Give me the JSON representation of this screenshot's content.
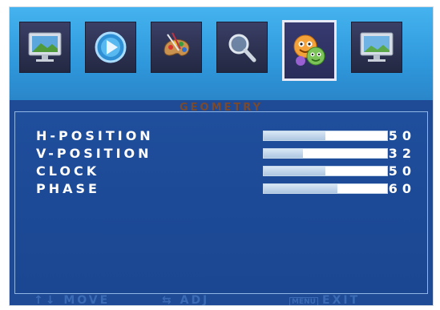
{
  "section_title": "GEOMETRY",
  "menu_icons": [
    {
      "name": "monitor-picture-icon",
      "active": false
    },
    {
      "name": "play-disc-icon",
      "active": false
    },
    {
      "name": "paint-palette-icon",
      "active": false
    },
    {
      "name": "magnifier-icon",
      "active": false
    },
    {
      "name": "smiley-faces-icon",
      "active": true
    },
    {
      "name": "monitor-screen-icon",
      "active": false
    }
  ],
  "settings": [
    {
      "label": "H-POSITION",
      "value": "50",
      "level_percent": 50
    },
    {
      "label": "V-POSITION",
      "value": "32",
      "level_percent": 32
    },
    {
      "label": "CLOCK",
      "value": "50",
      "level_percent": 50
    },
    {
      "label": "PHASE",
      "value": "60",
      "level_percent": 60
    }
  ],
  "footer": {
    "move": "↑↓ MOVE",
    "adjust": "⇆ ADJ",
    "menu_tag": "MENU",
    "exit": "EXIT"
  },
  "colors": {
    "panel_blue": "#1f4e9c",
    "header_blue": "#45b3ef",
    "title_brown": "#7a4a2f",
    "footer_text": "#3a6bb4"
  }
}
